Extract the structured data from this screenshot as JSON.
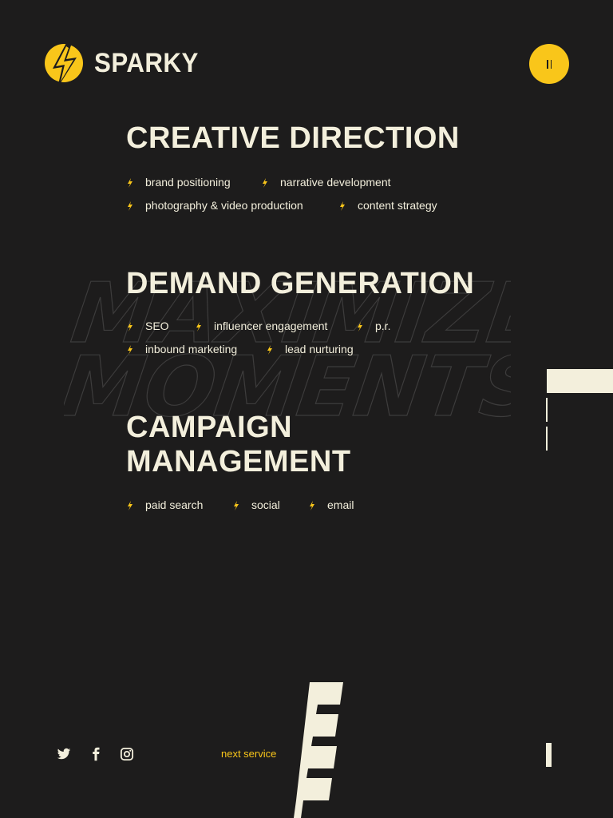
{
  "brand": {
    "name": "SPARKY",
    "accent": "#f9c61a",
    "background": "#1d1c1c",
    "text": "#f3efdc"
  },
  "menu_button": {
    "icon": "pause-bars-icon"
  },
  "background_watermark": {
    "lines": [
      "MAXIMIZE",
      "MOMENTS"
    ]
  },
  "sections": [
    {
      "title_lines": [
        "CREATIVE DIRECTION"
      ],
      "tags": [
        "brand positioning",
        "narrative development",
        "photography & video production",
        "content strategy"
      ]
    },
    {
      "title_lines": [
        "DEMAND GENERATION"
      ],
      "tags": [
        "SEO",
        "influencer engagement",
        "p.r.",
        "inbound marketing",
        "lead nurturing"
      ]
    },
    {
      "title_lines": [
        "CAMPAIGN",
        "MANAGEMENT"
      ],
      "tags": [
        "paid search",
        "social",
        "email"
      ]
    }
  ],
  "footer": {
    "social_icons": [
      "twitter-icon",
      "facebook-icon",
      "instagram-icon"
    ],
    "next_label": "next service",
    "big_letter": "E"
  }
}
